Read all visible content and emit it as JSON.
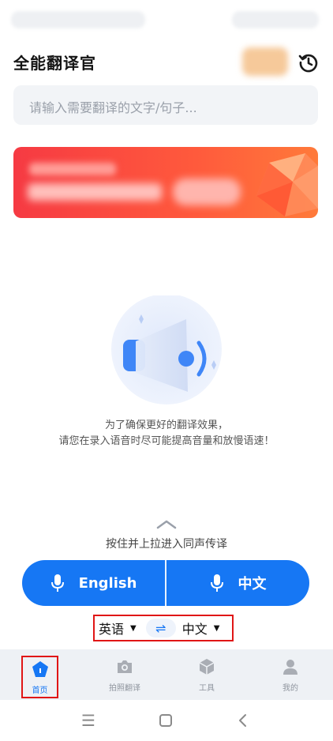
{
  "header": {
    "title": "全能翻译官"
  },
  "search": {
    "placeholder": "请输入需要翻译的文字/句子..."
  },
  "voice": {
    "hint_line1": "为了确保更好的翻译效果，",
    "hint_line2": "请您在录入语音时尽可能提高音量和放慢语速！",
    "pull_hint": "按住并上拉进入同声传译",
    "left_button": "English",
    "right_button": "中文"
  },
  "language": {
    "source": "英语",
    "target": "中文",
    "swap_icon": "swap-arrows-icon"
  },
  "bottom_nav": {
    "items": [
      {
        "label": "首页",
        "icon": "home-icon"
      },
      {
        "label": "拍照翻译",
        "icon": "camera-icon"
      },
      {
        "label": "工具",
        "icon": "cube-icon"
      },
      {
        "label": "我的",
        "icon": "person-icon"
      }
    ]
  },
  "colors": {
    "accent": "#1677f4",
    "banner": "#f63a43",
    "highlight_border": "#e01616"
  }
}
